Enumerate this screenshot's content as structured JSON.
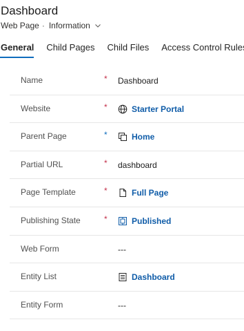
{
  "header": {
    "title": "Dashboard",
    "entity": "Web Page",
    "separator": "·",
    "form_name": "Information"
  },
  "tabs": [
    {
      "label": "General",
      "active": true
    },
    {
      "label": "Child Pages",
      "active": false
    },
    {
      "label": "Child Files",
      "active": false
    },
    {
      "label": "Access Control Rules",
      "active": false
    }
  ],
  "fields": [
    {
      "label": "Name",
      "required": "*",
      "value": "Dashboard"
    },
    {
      "label": "Website",
      "required": "*",
      "value": "Starter Portal",
      "icon": "globe-icon"
    },
    {
      "label": "Parent Page",
      "required": "*",
      "value": "Home",
      "icon": "pages-icon"
    },
    {
      "label": "Partial URL",
      "required": "*",
      "value": "dashboard"
    },
    {
      "label": "Page Template",
      "required": "*",
      "value": "Full Page",
      "icon": "document-icon"
    },
    {
      "label": "Publishing State",
      "required": "*",
      "value": "Published",
      "icon": "state-icon"
    },
    {
      "label": "Web Form",
      "required": "",
      "value": "---"
    },
    {
      "label": "Entity List",
      "required": "",
      "value": "Dashboard",
      "icon": "list-icon"
    },
    {
      "label": "Entity Form",
      "required": "",
      "value": "---"
    }
  ],
  "colors": {
    "accent": "#0f6cbd",
    "link": "#0f5ca8",
    "required": "#c4314b"
  }
}
